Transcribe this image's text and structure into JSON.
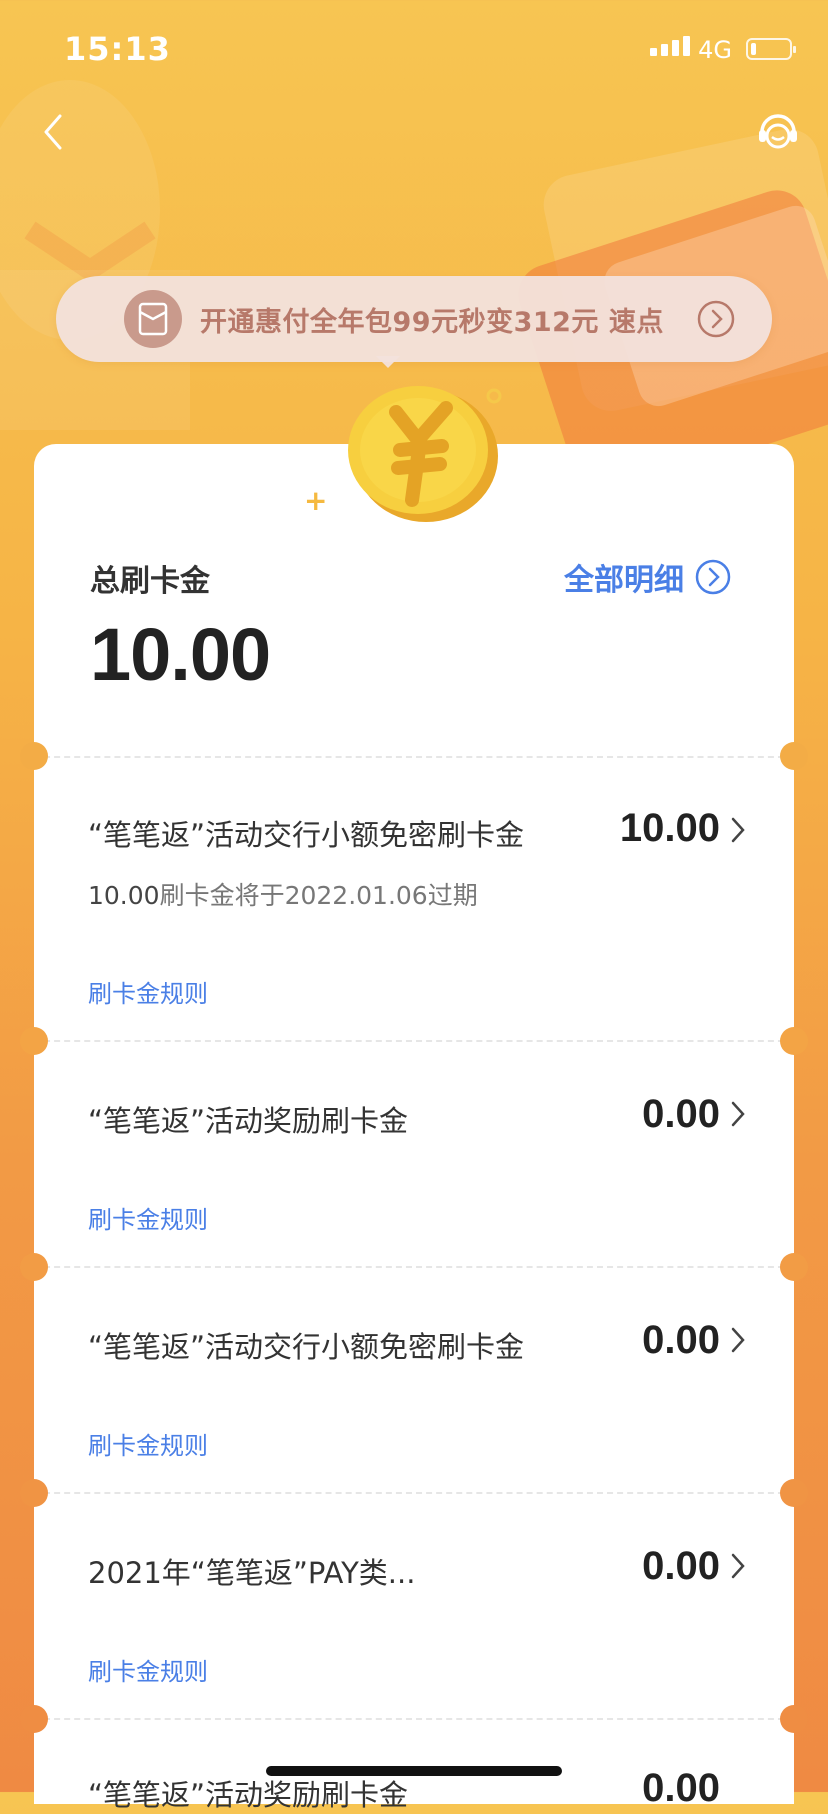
{
  "status_bar": {
    "time": "15:13",
    "network": "4G",
    "battery_level": 0.15
  },
  "colors": {
    "accent_blue": "#4a7fe6",
    "brand_orange": "#f29a45",
    "coin_yellow": "#f7c83a"
  },
  "promo": {
    "text": "开通惠付全年包99元秒变312元  速点"
  },
  "summary": {
    "label": "总刷卡金",
    "amount": "10.00",
    "detail_link": "全部明细"
  },
  "items": [
    {
      "title": "“笔笔返”活动交行小额免密刷卡金",
      "amount": "10.00",
      "expiry_amount": "10.00",
      "expiry_text": "刷卡金将于2022.01.06过期",
      "rule": "刷卡金规则"
    },
    {
      "title": "“笔笔返”活动奖励刷卡金",
      "amount": "0.00",
      "rule": "刷卡金规则"
    },
    {
      "title": "“笔笔返”活动交行小额免密刷卡金",
      "amount": "0.00",
      "rule": "刷卡金规则"
    },
    {
      "title": "2021年“笔笔返”PAY类...",
      "amount": "0.00",
      "rule": "刷卡金规则"
    },
    {
      "title": "“笔笔返”活动奖励刷卡金",
      "amount": "0.00"
    }
  ]
}
